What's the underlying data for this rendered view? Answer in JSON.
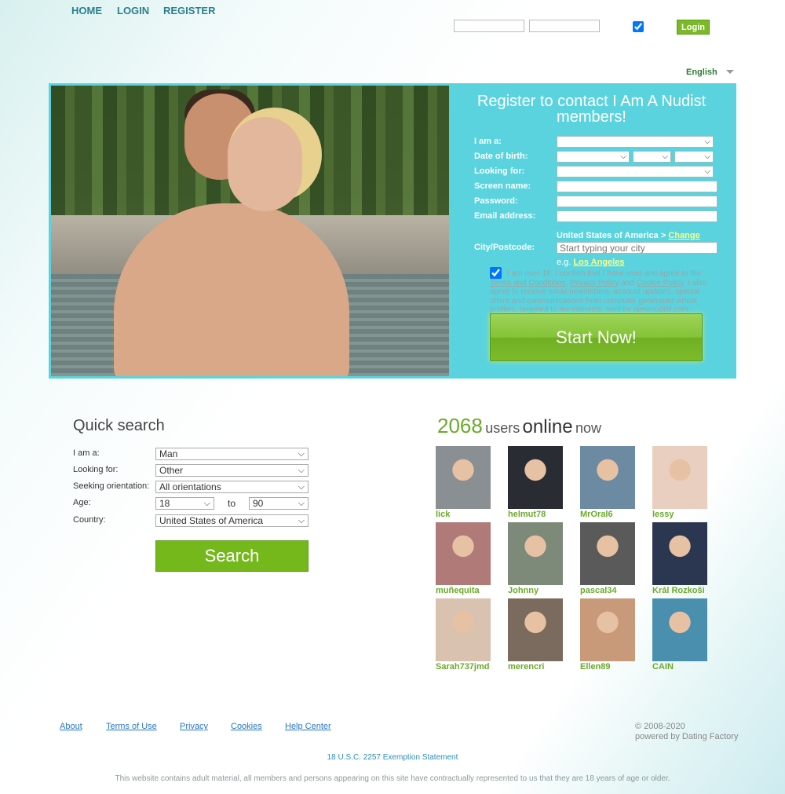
{
  "nav": {
    "home": "HOME",
    "login": "LOGIN",
    "register": "REGISTER"
  },
  "login_bar": {
    "username_value": "",
    "password_value": "",
    "remember_checked": true,
    "login_label": "Login"
  },
  "language": {
    "selected": "English"
  },
  "register": {
    "title": "Register to contact I Am A Nudist members!",
    "labels": {
      "i_am": "I am a:",
      "dob": "Date of birth:",
      "looking_for": "Looking for:",
      "screen_name": "Screen name:",
      "password": "Password:",
      "email": "Email address:",
      "city": "City/Postcode:"
    },
    "country": "United States of America",
    "country_sep": ">",
    "change_country": "Change country",
    "city_placeholder": "Start typing your city",
    "example_prefix": "e.g.",
    "example_city": "Los Angeles",
    "agree_checked": true,
    "agree_text_1": "I am over 18. I confirm that I have read and agree to the",
    "terms": "Terms and Conditions",
    "comma": ",",
    "privacy": "Privacy Policy",
    "and": "and",
    "cookie": "Cookie Policy",
    "agree_text_2": ". I also agree to receive email newsletters, account updates, special offers and communications from computer generated virtual profiles, targeted to my interests, sent by iamanudist.com.",
    "start_label": "Start Now!"
  },
  "quick_search": {
    "title": "Quick search",
    "labels": {
      "i_am": "I am a:",
      "looking_for": "Looking for:",
      "orientation": "Seeking orientation:",
      "age": "Age:",
      "country": "Country:"
    },
    "values": {
      "i_am": "Man",
      "looking_for": "Other",
      "orientation": "All orientations",
      "age_from": "18",
      "age_to": "90",
      "country": "United States of America"
    },
    "to_label": "to",
    "search_label": "Search"
  },
  "online": {
    "count": "2068",
    "w1": "users",
    "w2": "online",
    "w3": "now"
  },
  "users": [
    {
      "name": "lick",
      "color": "#8a8f94"
    },
    {
      "name": "helmut78",
      "color": "#2a2c33"
    },
    {
      "name": "MrOral6",
      "color": "#6d8aa3"
    },
    {
      "name": "lessy",
      "color": "#e9cfc0"
    },
    {
      "name": "muñequita",
      "color": "#b07a78"
    },
    {
      "name": "Johnny",
      "color": "#7d8a7a"
    },
    {
      "name": "pascal34",
      "color": "#5a5a5a"
    },
    {
      "name": "Král Rozkoši",
      "color": "#2b3650"
    },
    {
      "name": "Sarah737jmd",
      "color": "#d9c2b0"
    },
    {
      "name": "merencri",
      "color": "#7a6b5e"
    },
    {
      "name": "Ellen89",
      "color": "#c99a7a"
    },
    {
      "name": "CAIN",
      "color": "#4a8fae"
    }
  ],
  "footer": {
    "links": [
      "About",
      "Terms of Use",
      "Privacy",
      "Cookies",
      "Help Center"
    ],
    "copyright": "© 2008-2020",
    "powered": "powered by Dating Factory",
    "exemption": "18 U.S.C. 2257 Exemption Statement",
    "disclaimer": "This website contains adult material, all members and persons appearing on this site have contractually represented to us that they are 18 years of age or older."
  },
  "colors": {
    "accent_green": "#7cb928",
    "hero_cyan": "#5bd3de",
    "link_blue": "#2677c5"
  }
}
